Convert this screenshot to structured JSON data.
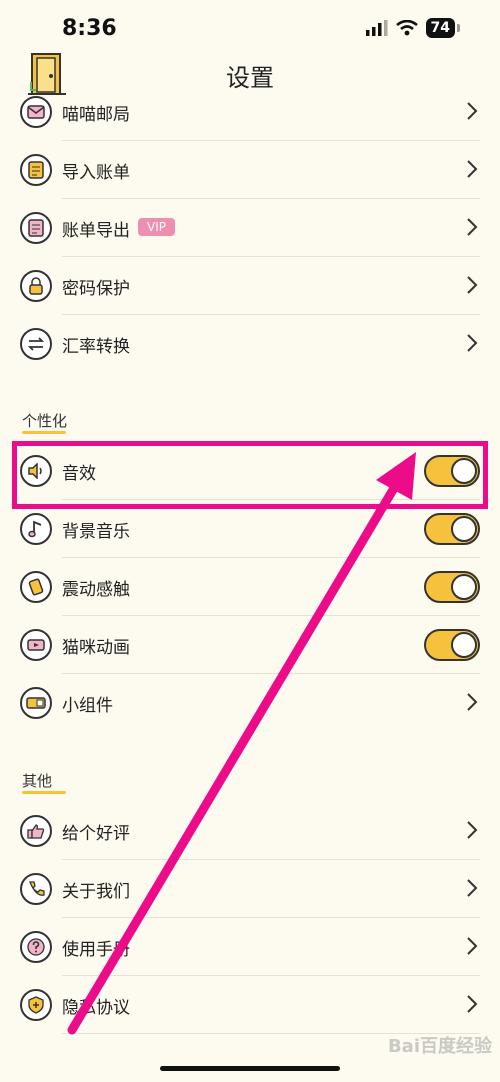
{
  "status_bar": {
    "time": "8:36",
    "battery": "74"
  },
  "header": {
    "title": "设置"
  },
  "top_items": [
    {
      "label": "喵喵邮局",
      "icon": "mail-icon"
    },
    {
      "label": "导入账单",
      "icon": "import-bill-icon"
    },
    {
      "label": "账单导出",
      "icon": "export-bill-icon",
      "badge": "VIP"
    },
    {
      "label": "密码保护",
      "icon": "lock-icon"
    },
    {
      "label": "汇率转换",
      "icon": "exchange-icon"
    }
  ],
  "personalization": {
    "title": "个性化",
    "items": [
      {
        "label": "音效",
        "icon": "speaker-icon",
        "toggle": true
      },
      {
        "label": "背景音乐",
        "icon": "music-note-icon",
        "toggle": true
      },
      {
        "label": "震动感触",
        "icon": "vibrate-icon",
        "toggle": true
      },
      {
        "label": "猫咪动画",
        "icon": "video-icon",
        "toggle": true
      },
      {
        "label": "小组件",
        "icon": "widget-icon"
      }
    ]
  },
  "other": {
    "title": "其他",
    "items": [
      {
        "label": "给个好评",
        "icon": "thumbs-up-icon"
      },
      {
        "label": "关于我们",
        "icon": "phone-icon"
      },
      {
        "label": "使用手册",
        "icon": "question-icon"
      },
      {
        "label": "隐私协议",
        "icon": "shield-icon"
      }
    ]
  },
  "watermark": "Bai百度经验",
  "colors": {
    "accent": "#f6c23e",
    "annotation": "#ec0c8a",
    "vip": "#ee8fb0"
  }
}
